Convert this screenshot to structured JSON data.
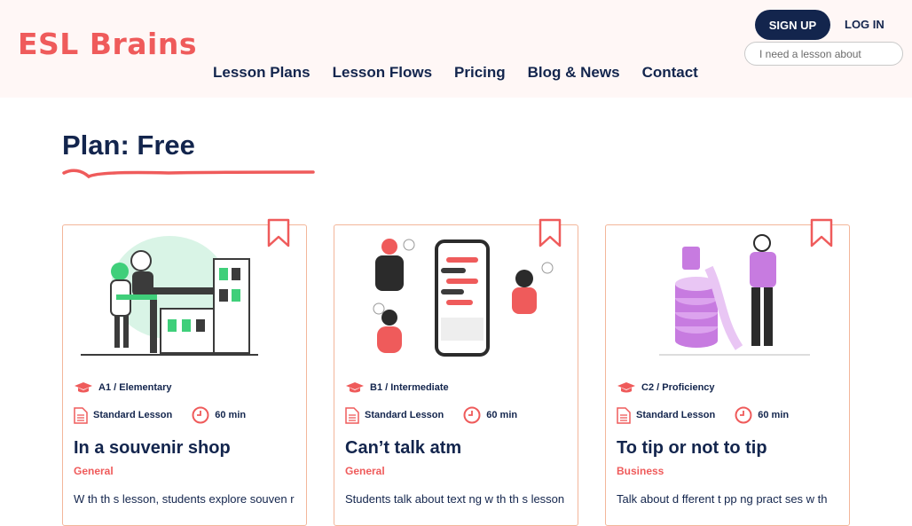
{
  "brand": {
    "logo": "ESL Brains",
    "accent": "#ef5b5b",
    "navy": "#13254d"
  },
  "nav": {
    "items": [
      "Lesson Plans",
      "Lesson Flows",
      "Pricing",
      "Blog & News",
      "Contact"
    ]
  },
  "auth": {
    "signup": "SIGN UP",
    "login": "LOG IN"
  },
  "search": {
    "placeholder": "I need a lesson about"
  },
  "page": {
    "title": "Plan: Free"
  },
  "cards": [
    {
      "level": "A1 / Elementary",
      "type": "Standard Lesson",
      "duration": "60 min",
      "title": "In a souvenir shop",
      "category": "General",
      "description": "W th th s lesson, students explore souven r"
    },
    {
      "level": "B1 / Intermediate",
      "type": "Standard Lesson",
      "duration": "60 min",
      "title": "Can’t talk atm",
      "category": "General",
      "description": "Students talk about text ng w th th s lesson"
    },
    {
      "level": "C2 / Proficiency",
      "type": "Standard Lesson",
      "duration": "60 min",
      "title": "To tip or not to tip",
      "category": "Business",
      "description": "Talk about d fferent t pp ng pract ses w th"
    }
  ]
}
